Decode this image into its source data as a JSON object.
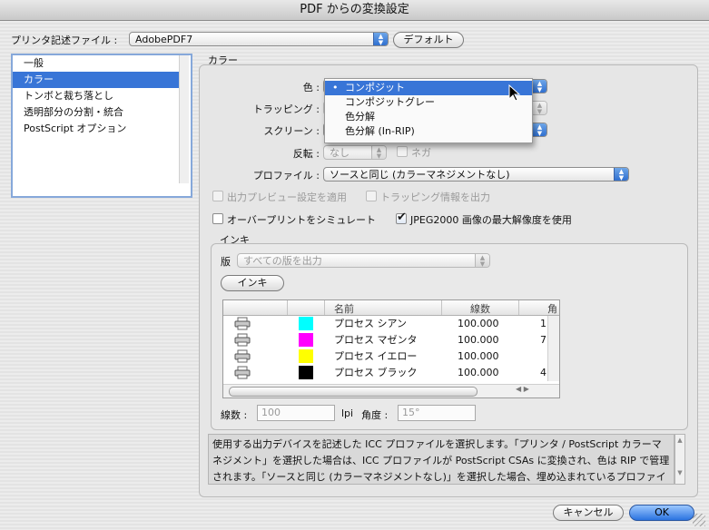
{
  "window": {
    "title": "PDF からの変換設定"
  },
  "printer_file": {
    "label": "プリンタ記述ファイル :",
    "value": "AdobePDF7",
    "default_button": "デフォルト"
  },
  "sidebar": {
    "items": [
      {
        "label": "一般"
      },
      {
        "label": "カラー"
      },
      {
        "label": "トンボと裁ち落とし"
      },
      {
        "label": "透明部分の分割・統合"
      },
      {
        "label": "PostScript オプション"
      }
    ],
    "selected_index": 1
  },
  "panel": {
    "title": "カラー"
  },
  "color": {
    "label": "色 :",
    "menu_items": [
      "コンポジット",
      "コンポジットグレー",
      "色分解",
      "色分解 (In-RIP)"
    ],
    "selected": "コンポジット"
  },
  "trapping": {
    "label": "トラッピング :"
  },
  "screen": {
    "label": "スクリーン :"
  },
  "invert": {
    "label": "反転 :",
    "value": "なし",
    "negative_label": "ネガ"
  },
  "profile": {
    "label": "プロファイル :",
    "value": "ソースと同じ (カラーマネジメントなし)"
  },
  "options": {
    "output_preview": "出力プレビュー設定を適用",
    "trap_info": "トラッピング情報を出力",
    "overprint": "オーバープリントをシミュレート",
    "jpeg2000": "JPEG2000 画像の最大解像度を使用",
    "jpeg2000_checked": true
  },
  "ink": {
    "group_label": "インキ",
    "plate_label": "版",
    "plate_value": "すべての版を出力",
    "ink_button": "インキ",
    "columns": [
      "",
      "",
      "名前",
      "線数",
      "角"
    ],
    "rows": [
      {
        "name": "プロセス シアン",
        "freq": "100.000",
        "angle": "1",
        "color": "#00ffff"
      },
      {
        "name": "プロセス マゼンタ",
        "freq": "100.000",
        "angle": "7",
        "color": "#ff00ff"
      },
      {
        "name": "プロセス イエロー",
        "freq": "100.000",
        "angle": "",
        "color": "#ffff00"
      },
      {
        "name": "プロセス ブラック",
        "freq": "100.000",
        "angle": "4",
        "color": "#000000"
      }
    ],
    "freq_label": "線数 :",
    "freq_value": "100",
    "lpi": "lpi",
    "angle_label": "角度 :",
    "angle_value": "15°"
  },
  "description": "使用する出力デバイスを記述した ICC プロファイルを選択します。「プリンタ / PostScript カラーマネジメント」を選択した場合は、ICC プロファイルが PostScript CSAs に変換され、色は RIP で管理されます。「ソースと同じ (カラーマネジメントなし)」を選択した場合、埋め込まれているプロファイル",
  "buttons": {
    "cancel": "キャンセル",
    "ok": "OK"
  },
  "colors": {
    "accent": "#3875d7",
    "sidebar_border": "#86a8da"
  }
}
